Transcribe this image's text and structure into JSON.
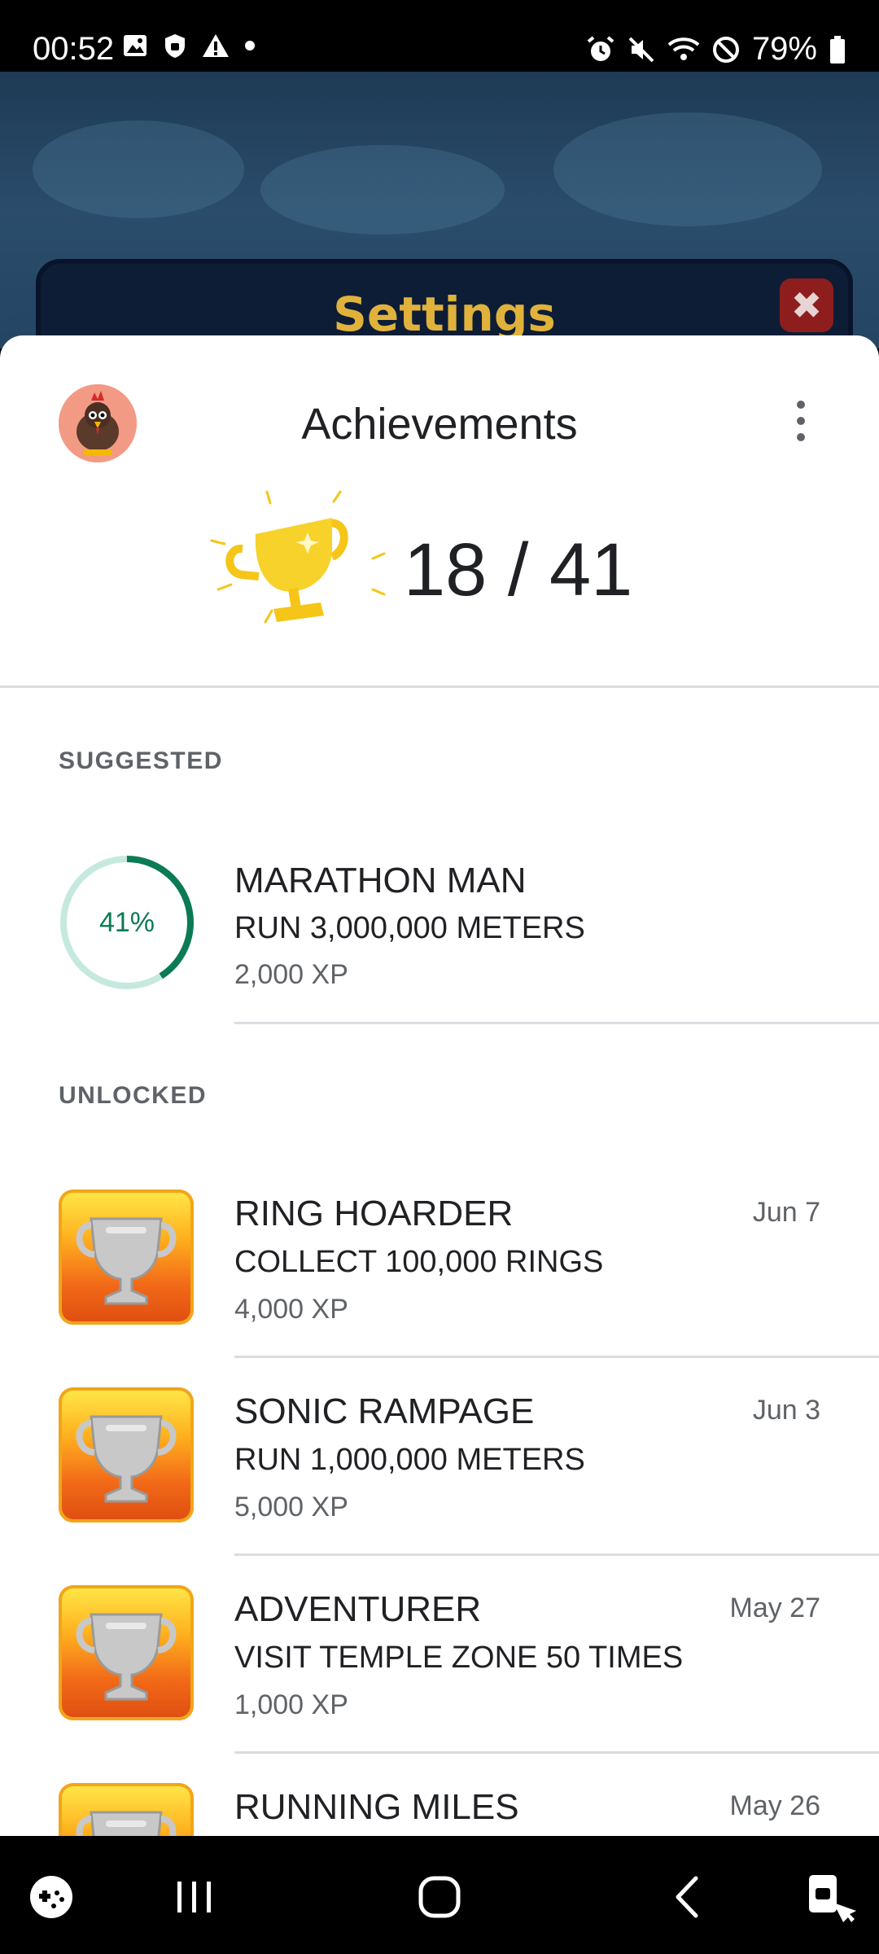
{
  "status_bar": {
    "time": "00:52",
    "battery": "79%",
    "icons_left": [
      "image-icon",
      "shield-icon",
      "warning-icon",
      "dot-icon"
    ],
    "icons_right": [
      "alarm-icon",
      "mute-icon",
      "wifi-icon",
      "block-icon",
      "battery-icon"
    ]
  },
  "game_background": {
    "settings_title": "Settings",
    "close_icon": "close-icon"
  },
  "sheet": {
    "title": "Achievements",
    "unlocked_count": "18 / 41",
    "sections": {
      "suggested": "SUGGESTED",
      "unlocked": "UNLOCKED"
    },
    "suggested": [
      {
        "progress": 0.41,
        "progress_label": "41%",
        "title": "MARATHON MAN",
        "description": "RUN 3,000,000 METERS",
        "xp": "2,000 XP"
      }
    ],
    "unlocked": [
      {
        "title": "RING HOARDER",
        "description": "COLLECT 100,000 RINGS",
        "xp": "4,000 XP",
        "date": "Jun 7"
      },
      {
        "title": "SONIC RAMPAGE",
        "description": "RUN 1,000,000 METERS",
        "xp": "5,000 XP",
        "date": "Jun 3"
      },
      {
        "title": "ADVENTURER",
        "description": "VISIT TEMPLE ZONE 50 TIMES",
        "xp": "1,000 XP",
        "date": "May 27"
      },
      {
        "title": "RUNNING MILES",
        "description": "",
        "xp": "",
        "date": "May 26"
      }
    ]
  },
  "colors": {
    "progress_accent": "#0b7a55",
    "progress_track": "#c6e9df",
    "badge_top": "#ffe94a",
    "badge_bottom": "#de4d10"
  },
  "nav_bar": {
    "icons": [
      "game-tools-icon",
      "recents-icon",
      "home-icon",
      "back-icon",
      "screen-lock-icon"
    ]
  }
}
